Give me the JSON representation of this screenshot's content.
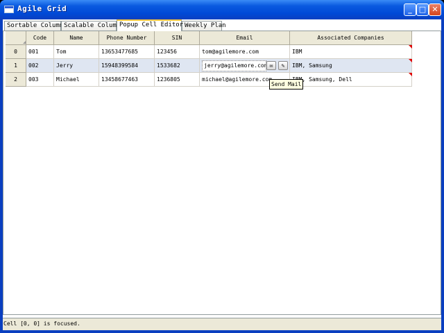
{
  "window": {
    "title": "Agile Grid"
  },
  "tabs": [
    "Sortable Column",
    "Scalable Column",
    "Popup Cell Editor",
    "Weekly Plan"
  ],
  "grid": {
    "columns": [
      "Code",
      "Name",
      "Phone Number",
      "SIN",
      "Email",
      "Associated Companies"
    ],
    "rows": [
      {
        "index": "0",
        "code": "001",
        "name": "Tom",
        "phone": "13653477685",
        "sin": "123456",
        "email": "tom@agilemore.com",
        "companies": "IBM"
      },
      {
        "index": "1",
        "code": "002",
        "name": "Jerry",
        "phone": "15948399584",
        "sin": "1533682",
        "email": "jerry@agilemore.com",
        "companies": "IBM, Samsung"
      },
      {
        "index": "2",
        "code": "003",
        "name": "Michael",
        "phone": "13458677463",
        "sin": "1236805",
        "email": "michael@agilemore.com",
        "companies": "IBM, Samsung, Dell"
      }
    ]
  },
  "tooltip": {
    "text": "Send Mail"
  },
  "status": {
    "text": "Cell [0, 0] is focused."
  }
}
